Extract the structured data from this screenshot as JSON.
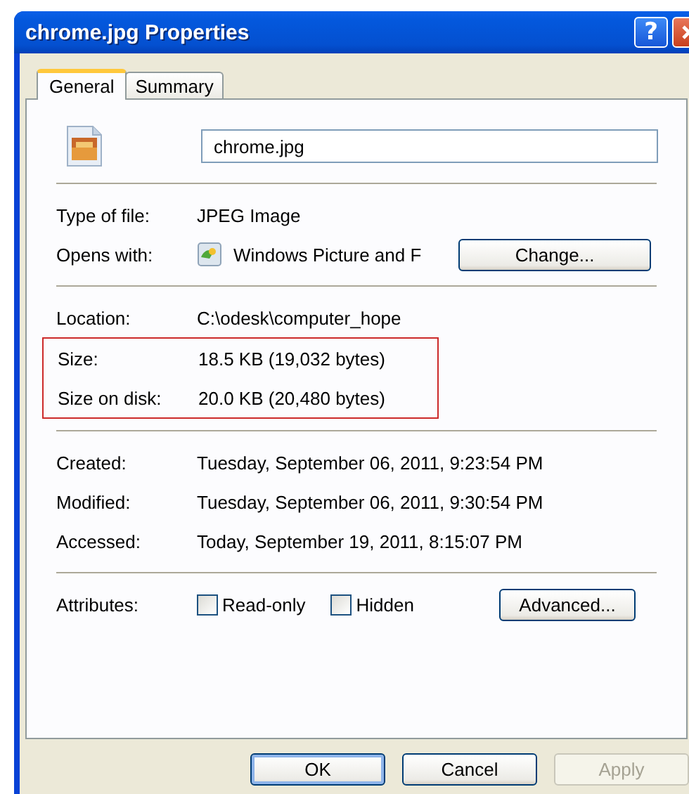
{
  "window": {
    "title": "chrome.jpg Properties",
    "help_button": "?"
  },
  "tabs": [
    {
      "label": "General",
      "selected": true
    },
    {
      "label": "Summary",
      "selected": false
    }
  ],
  "file_name": {
    "value": "chrome.jpg"
  },
  "sections": [
    {
      "rows": [
        {
          "kind": "text",
          "label": "Type of file:",
          "value": "JPEG Image",
          "highlighted": false
        },
        {
          "kind": "app",
          "label": "Opens with:",
          "value": "Windows Picture and F",
          "button": "Change...",
          "highlighted": false
        }
      ]
    },
    {
      "rows": [
        {
          "kind": "text",
          "label": "Location:",
          "value": "C:\\odesk\\computer_hope",
          "highlighted": false
        },
        {
          "kind": "text",
          "label": "Size:",
          "value": "18.5 KB (19,032 bytes)",
          "highlighted": true
        },
        {
          "kind": "text",
          "label": "Size on disk:",
          "value": "20.0 KB (20,480 bytes)",
          "highlighted": true
        }
      ]
    },
    {
      "rows": [
        {
          "kind": "text",
          "label": "Created:",
          "value": "Tuesday, September 06, 2011, 9:23:54 PM",
          "highlighted": false
        },
        {
          "kind": "text",
          "label": "Modified:",
          "value": "Tuesday, September 06, 2011, 9:30:54 PM",
          "highlighted": false
        },
        {
          "kind": "text",
          "label": "Accessed:",
          "value": "Today, September 19, 2011, 8:15:07 PM",
          "highlighted": false
        }
      ]
    }
  ],
  "attributes": {
    "label": "Attributes:",
    "checkboxes": [
      {
        "label": "Read-only",
        "checked": false
      },
      {
        "label": "Hidden",
        "checked": false
      }
    ],
    "button": "Advanced..."
  },
  "buttons": [
    {
      "label": "OK",
      "default": true,
      "disabled": false
    },
    {
      "label": "Cancel",
      "default": false,
      "disabled": false
    },
    {
      "label": "Apply",
      "default": false,
      "disabled": true
    }
  ]
}
